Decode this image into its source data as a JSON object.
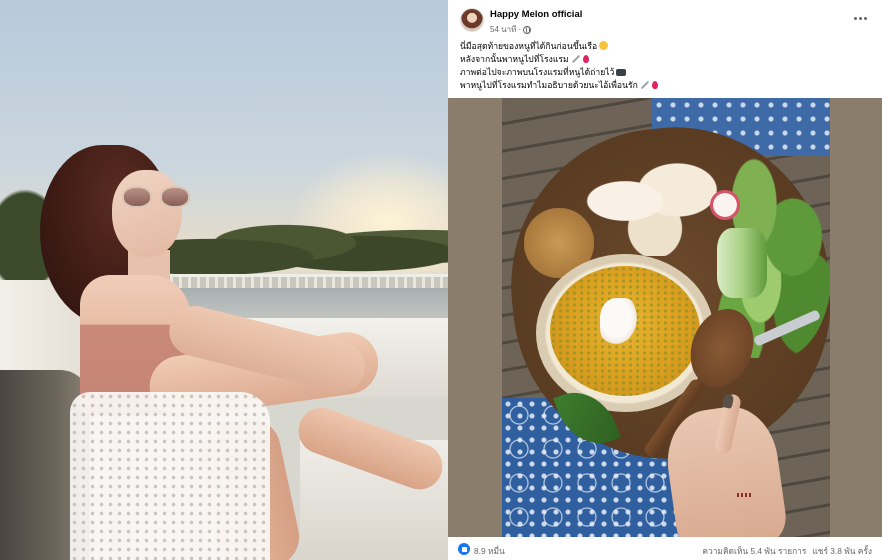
{
  "post": {
    "author": "Happy Melon official",
    "timestamp": "54 นาที",
    "caption_lines": [
      "นี่มือสุดท้ายของหนูที่ได้กินก่อนขึ้นเรือ",
      "หลังจากนั้นพาหนูไปที่โรงแรม",
      "ภาพต่อไปจะภาพบนโรงแรมที่หนูได้ถ่ายไว้",
      "พาหนูไปที่โรงแรมทำไมอธิบายด้วยนะไอ้เพื่อนรัก"
    ],
    "reactions": "8.9 หมื่น",
    "comments": "ความคิดเห็น 5.4 พัน รายการ",
    "shares": "แชร์ 3.8 พัน ครั้ง"
  },
  "icons": {
    "avatar": "profile-avatar",
    "audience": "globe-icon",
    "more": "more-options-icon",
    "reaction": "like-icon",
    "emoji": [
      "smile-emoji",
      "syringe-emoji",
      "blood-drop-emoji",
      "camera-emoji"
    ]
  },
  "colors": {
    "facebook_blue": "#1877f2",
    "secondary_text": "#65676b",
    "primary_text": "#050505"
  }
}
